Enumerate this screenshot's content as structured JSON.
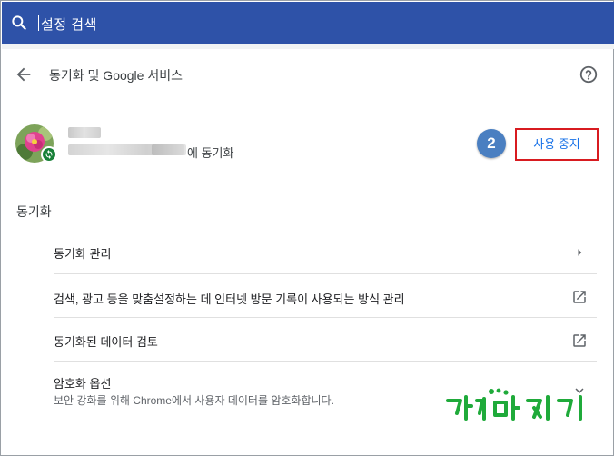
{
  "search": {
    "placeholder": "설정 검색"
  },
  "header": {
    "title": "동기화 및 Google 서비스"
  },
  "account": {
    "sync_target_suffix": "에 동기화",
    "step_number": "2",
    "stop_button_label": "사용 중지"
  },
  "section": {
    "title": "동기화"
  },
  "rows": [
    {
      "label": "동기화 관리",
      "icon": "chevron-right-icon"
    },
    {
      "label": "검색, 광고 등을 맞춤설정하는 데 인터넷 방문 기록이 사용되는 방식 관리",
      "icon": "external-link-icon"
    },
    {
      "label": "동기화된 데이터 검토",
      "icon": "external-link-icon"
    },
    {
      "label": "암호화 옵션",
      "sublabel": "보안 강화를 위해 Chrome에서 사용자 데이터를 암호화합니다.",
      "icon": "chevron-down-icon"
    }
  ],
  "colors": {
    "search_bar": "#2e52a8",
    "link": "#1a73e8",
    "highlight_box": "#d81b20",
    "step_badge": "#4a7fc1",
    "sync_badge": "#188038"
  }
}
